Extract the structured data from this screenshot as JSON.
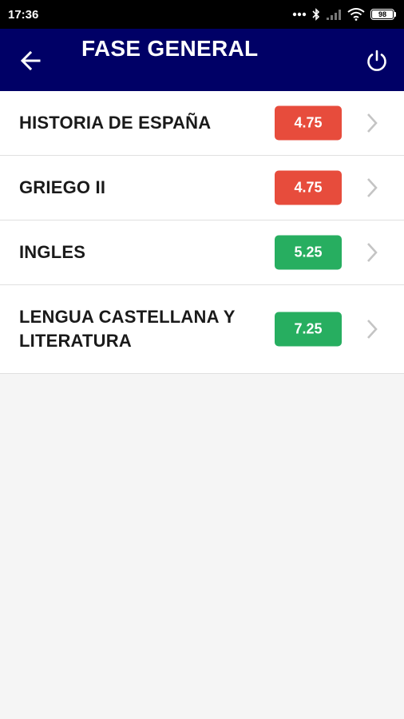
{
  "status_bar": {
    "time": "17:36",
    "battery_level": "98",
    "icons": [
      "dots-icon",
      "bluetooth-icon",
      "signal-icon",
      "wifi-icon",
      "battery-icon"
    ]
  },
  "header": {
    "title": "FASE GENERAL",
    "background_color": "#000066",
    "back_icon": "arrow-left-icon",
    "power_icon": "power-icon"
  },
  "subjects": [
    {
      "name": "HISTORIA DE ESPAÑA",
      "grade": "4.75",
      "status": "fail"
    },
    {
      "name": "GRIEGO II",
      "grade": "4.75",
      "status": "fail"
    },
    {
      "name": "INGLES",
      "grade": "5.25",
      "status": "pass"
    },
    {
      "name": "LENGUA CASTELLANA Y LITERATURA",
      "grade": "7.25",
      "status": "pass"
    }
  ],
  "colors": {
    "fail": "#e74c3c",
    "pass": "#27ae60"
  }
}
